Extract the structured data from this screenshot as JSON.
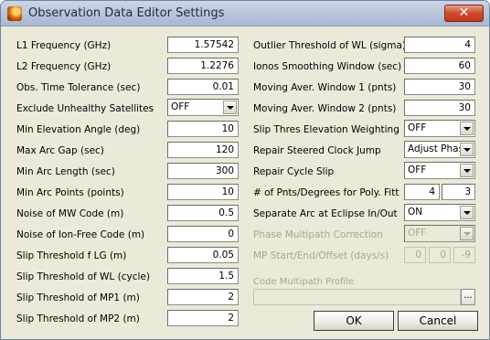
{
  "window": {
    "title": "Observation Data Editor Settings",
    "close_label": "✕"
  },
  "left": {
    "l1_freq": {
      "label": "L1 Frequency (GHz)",
      "value": "1.57542"
    },
    "l2_freq": {
      "label": "L2 Frequency (GHz)",
      "value": "1.2276"
    },
    "obs_time_tol": {
      "label": "Obs. Time Tolerance (sec)",
      "value": "0.01"
    },
    "exclude_unhealthy": {
      "label": "Exclude Unhealthy Satellites",
      "value": "OFF"
    },
    "min_elev": {
      "label": "Min Elevation Angle (deg)",
      "value": "10"
    },
    "max_arc_gap": {
      "label": "Max Arc Gap (sec)",
      "value": "120"
    },
    "min_arc_len": {
      "label": "Min Arc Length (sec)",
      "value": "300"
    },
    "min_arc_points": {
      "label": "Min Arc Points (points)",
      "value": "10"
    },
    "noise_mw": {
      "label": "Noise of MW Code (m)",
      "value": "0.5"
    },
    "noise_ionfree": {
      "label": "Noise of Ion-Free Code (m)",
      "value": "0"
    },
    "slip_flg": {
      "label": "Slip Threshold f LG (m)",
      "value": "0.05"
    },
    "slip_wl": {
      "label": "Slip Threshold of WL (cycle)",
      "value": "1.5"
    },
    "slip_mp1": {
      "label": "Slip Threshold of MP1 (m)",
      "value": "2"
    },
    "slip_mp2": {
      "label": "Slip Threshold of MP2 (m)",
      "value": "2"
    }
  },
  "right": {
    "outlier_wl": {
      "label": "Outlier Threshold of WL (sigma)",
      "value": "4"
    },
    "iono_smooth": {
      "label": "Ionos Smoothing Window (sec)",
      "value": "60"
    },
    "mov_avg1": {
      "label": "Moving Aver. Window 1 (pnts)",
      "value": "30"
    },
    "mov_avg2": {
      "label": "Moving Aver. Window 2 (pnts)",
      "value": "30"
    },
    "slip_elev_weight": {
      "label": "Slip Thres Elevation Weighting",
      "value": "OFF"
    },
    "repair_clock": {
      "label": "Repair Steered Clock Jump",
      "value": "Adjust Phase"
    },
    "repair_slip": {
      "label": "Repair Cycle Slip",
      "value": "OFF"
    },
    "poly_fit": {
      "label": "# of Pnts/Degrees for Poly. Fitt",
      "points": "4",
      "degrees": "3"
    },
    "separate_arc": {
      "label": "Separate Arc at Eclipse In/Out",
      "value": "ON"
    },
    "phase_mp_corr": {
      "label": "Phase Multipath Correction",
      "value": "OFF"
    },
    "mp_offset": {
      "label": "MP Start/End/Offset (days/s)",
      "start": "0",
      "end": "0",
      "offset": "-9"
    },
    "code_mp_profile": {
      "label": "Code Multipath Profile",
      "value": "",
      "browse_label": "..."
    }
  },
  "buttons": {
    "ok": "OK",
    "cancel": "Cancel"
  }
}
